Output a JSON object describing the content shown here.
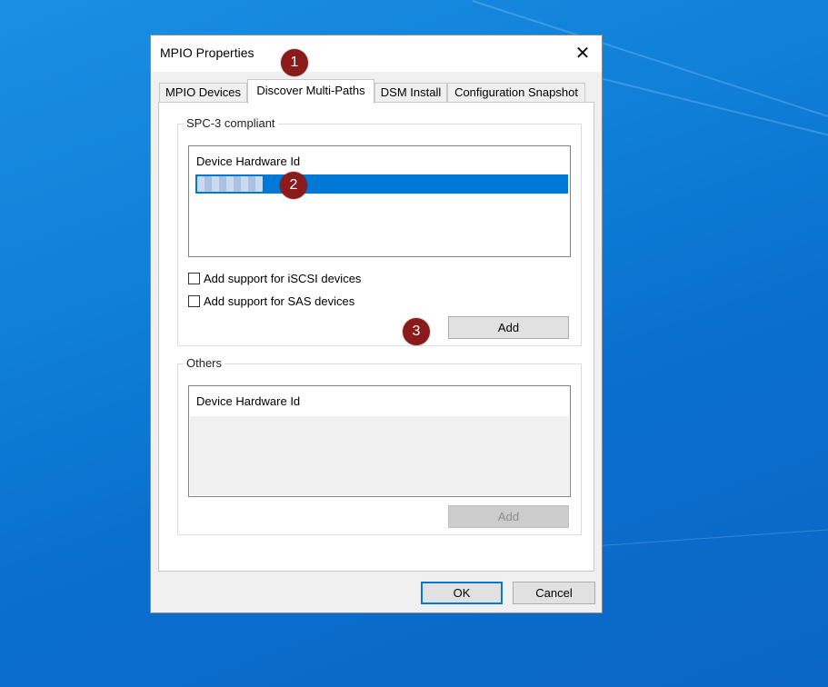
{
  "window": {
    "title": "MPIO Properties",
    "close_glyph": "✕"
  },
  "tabs": [
    {
      "label": "MPIO Devices",
      "active": false
    },
    {
      "label": "Discover Multi-Paths",
      "active": true
    },
    {
      "label": "DSM Install",
      "active": false
    },
    {
      "label": "Configuration Snapshot",
      "active": false
    }
  ],
  "spc3": {
    "legend": "SPC-3 compliant",
    "list_header": "Device Hardware Id",
    "checkbox_iscsi": "Add support for iSCSI devices",
    "checkbox_sas": "Add support for SAS devices",
    "add_label": "Add"
  },
  "others": {
    "legend": "Others",
    "list_header": "Device Hardware Id",
    "add_label": "Add"
  },
  "footer": {
    "ok_label": "OK",
    "cancel_label": "Cancel"
  },
  "markers": [
    "1",
    "2",
    "3"
  ],
  "colors": {
    "selection": "#0078d7",
    "marker": "#8b1a1a",
    "default_button_border": "#0078d7"
  }
}
